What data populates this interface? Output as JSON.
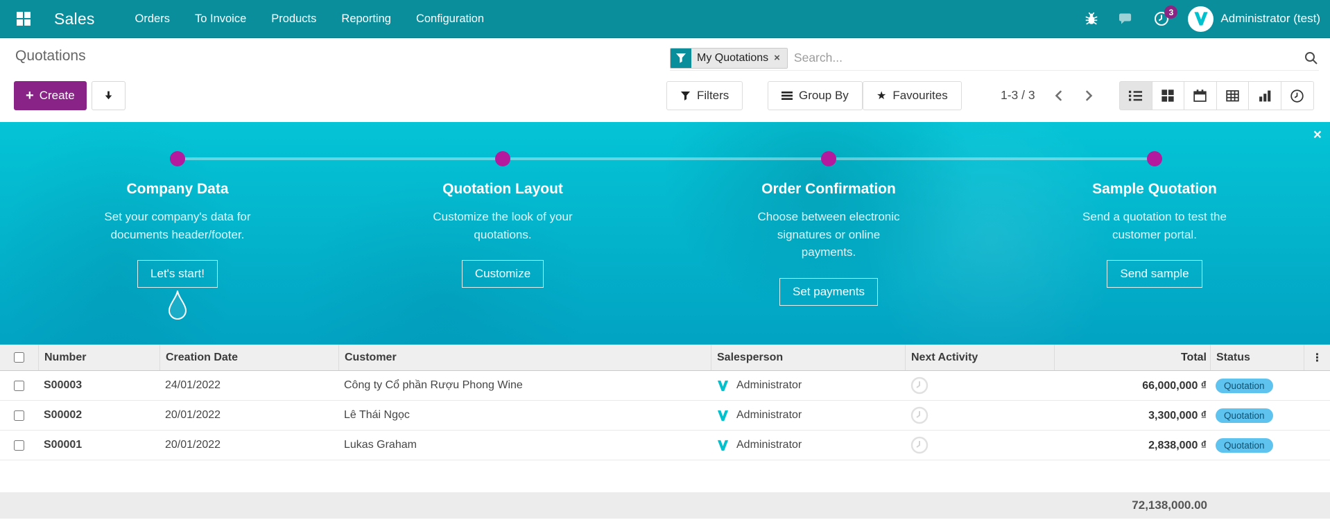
{
  "topbar": {
    "app_name": "Sales",
    "menus": [
      "Orders",
      "To Invoice",
      "Products",
      "Reporting",
      "Configuration"
    ],
    "activity_badge": "3",
    "user_name": "Administrator (test)"
  },
  "control_panel": {
    "title": "Quotations",
    "create_label": "Create",
    "search": {
      "facet_label": "My Quotations",
      "placeholder": "Search..."
    },
    "buttons": {
      "filters": "Filters",
      "group_by": "Group By",
      "favourites": "Favourites"
    },
    "pager": "1-3 / 3"
  },
  "banner": {
    "steps": [
      {
        "title": "Company Data",
        "description": "Set your company's data for documents header/footer.",
        "button": "Let's start!"
      },
      {
        "title": "Quotation Layout",
        "description": "Customize the look of your quotations.",
        "button": "Customize"
      },
      {
        "title": "Order Confirmation",
        "description": "Choose between electronic signatures or online payments.",
        "button": "Set payments"
      },
      {
        "title": "Sample Quotation",
        "description": "Send a quotation to test the customer portal.",
        "button": "Send sample"
      }
    ]
  },
  "table": {
    "columns": [
      "Number",
      "Creation Date",
      "Customer",
      "Salesperson",
      "Next Activity",
      "Total",
      "Status"
    ],
    "rows": [
      {
        "number": "S00003",
        "creation_date": "24/01/2022",
        "customer": "Công ty Cổ phần Rượu Phong Wine",
        "salesperson": "Administrator",
        "total": "66,000,000 ₫",
        "status": "Quotation"
      },
      {
        "number": "S00002",
        "creation_date": "20/01/2022",
        "customer": "Lê Thái Ngọc",
        "salesperson": "Administrator",
        "total": "3,300,000 ₫",
        "status": "Quotation"
      },
      {
        "number": "S00001",
        "creation_date": "20/01/2022",
        "customer": "Lukas Graham",
        "salesperson": "Administrator",
        "total": "2,838,000 ₫",
        "status": "Quotation"
      }
    ],
    "footer_total": "72,138,000.00"
  },
  "icons": {
    "close": "×",
    "facet_remove": "×",
    "star": "★",
    "more": "⋮",
    "plus": "+"
  },
  "colors": {
    "topbar_teal": "#0a8e9c",
    "banner_cyan_top": "#05c4d6",
    "banner_cyan_bottom": "#02a3c3",
    "accent_magenta": "#b31a9e",
    "create_purple": "#8a2387",
    "status_badge_blue": "#5fc3f0"
  }
}
